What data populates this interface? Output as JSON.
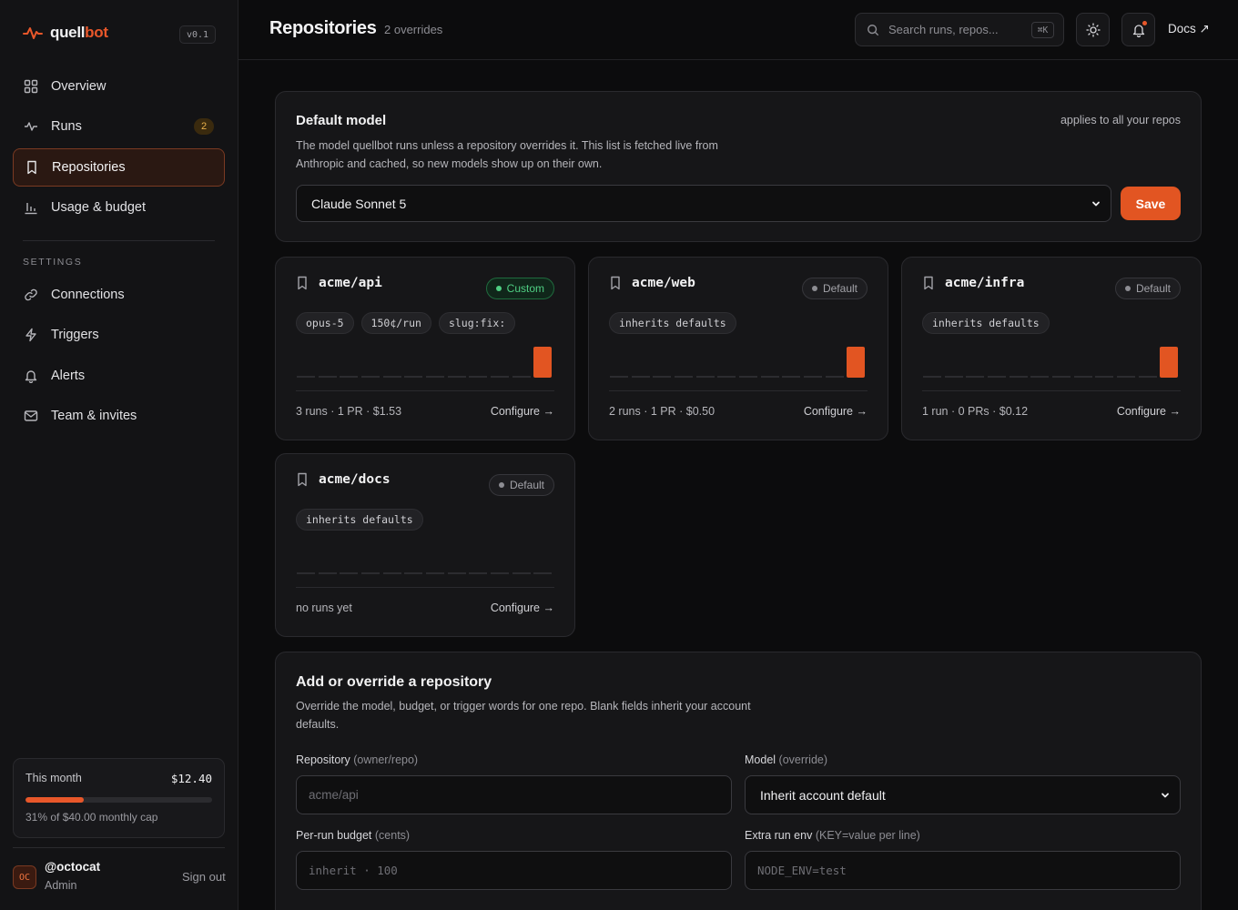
{
  "brand": {
    "name_main": "quell",
    "name_accent": "bot",
    "version": "v0.1"
  },
  "sidebar": {
    "items": [
      {
        "label": "Overview",
        "icon": "grid-icon"
      },
      {
        "label": "Runs",
        "icon": "pulse-icon",
        "badge": "2"
      },
      {
        "label": "Repositories",
        "icon": "bookmark-icon",
        "active": true
      },
      {
        "label": "Usage & budget",
        "icon": "bar-chart-icon"
      }
    ],
    "settings_heading": "SETTINGS",
    "settings_items": [
      {
        "label": "Connections",
        "icon": "link-icon"
      },
      {
        "label": "Triggers",
        "icon": "bolt-icon"
      },
      {
        "label": "Alerts",
        "icon": "bell-icon"
      },
      {
        "label": "Team & invites",
        "icon": "mail-icon"
      }
    ],
    "budget": {
      "label": "This month",
      "amount": "$12.40",
      "fraction": 0.31,
      "note": "31% of $40.00 monthly cap"
    },
    "user": {
      "initials": "OC",
      "handle": "@octocat",
      "role": "Admin",
      "signout": "Sign out"
    }
  },
  "header": {
    "title": "Repositories",
    "subtitle": "2 overrides",
    "search_placeholder": "Search runs, repos...",
    "search_shortcut": "⌘K",
    "docs_label": "Docs ↗"
  },
  "default_model": {
    "title": "Default model",
    "applies": "applies to all your repos",
    "description": "The model quellbot runs unless a repository overrides it. This list is fetched live from Anthropic and cached, so new models show up on their own.",
    "selected": "Claude Sonnet 5",
    "save_label": "Save"
  },
  "repos": [
    {
      "name": "acme/api",
      "status": "Custom",
      "tags": [
        "opus-5",
        "150¢/run",
        "slug:fix:"
      ],
      "stats": "3 runs · 1 PR · $1.53",
      "configure": "Configure →",
      "activity": [
        0,
        0,
        0,
        0,
        0,
        0,
        0,
        0,
        0,
        0,
        0,
        1
      ]
    },
    {
      "name": "acme/web",
      "status": "Default",
      "tags": [
        "inherits defaults"
      ],
      "stats": "2 runs · 1 PR · $0.50",
      "configure": "Configure →",
      "activity": [
        0,
        0,
        0,
        0,
        0,
        0,
        0,
        0,
        0,
        0,
        0,
        1
      ]
    },
    {
      "name": "acme/infra",
      "status": "Default",
      "tags": [
        "inherits defaults"
      ],
      "stats": "1 run · 0 PRs · $0.12",
      "configure": "Configure →",
      "activity": [
        0,
        0,
        0,
        0,
        0,
        0,
        0,
        0,
        0,
        0,
        0,
        1
      ]
    },
    {
      "name": "acme/docs",
      "status": "Default",
      "tags": [
        "inherits defaults"
      ],
      "stats": "no runs yet",
      "configure": "Configure →",
      "activity": [
        0,
        0,
        0,
        0,
        0,
        0,
        0,
        0,
        0,
        0,
        0,
        0
      ]
    }
  ],
  "add_repo": {
    "title": "Add or override a repository",
    "description": "Override the model, budget, or trigger words for one repo. Blank fields inherit your account defaults.",
    "repo_label": "Repository",
    "repo_hint": "(owner/repo)",
    "repo_placeholder": "acme/api",
    "model_label": "Model",
    "model_hint": "(override)",
    "model_selected": "Inherit account default",
    "budget_label": "Per-run budget",
    "budget_hint": "(cents)",
    "budget_placeholder": "inherit · 100",
    "env_label": "Extra run env",
    "env_hint": "(KEY=value per line)",
    "env_placeholder": "NODE_ENV=test"
  },
  "colors": {
    "accent": "#e25522",
    "custom_green": "#4fcf83",
    "badge_amber": "#e8b04a"
  }
}
